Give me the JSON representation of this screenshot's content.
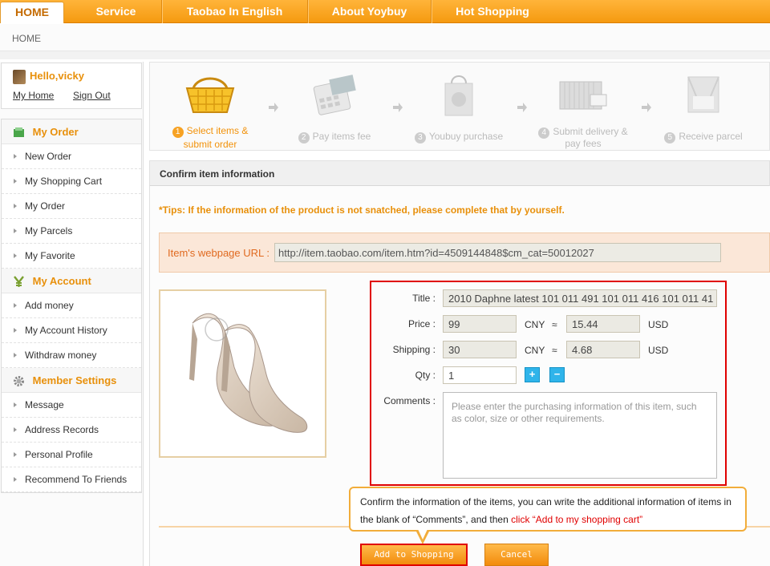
{
  "nav": {
    "home": "HOME",
    "service": "Service",
    "taobao": "Taobao In English",
    "about": "About Yoybuy",
    "hot": "Hot Shopping"
  },
  "breadcrumb": "HOME",
  "user": {
    "greeting": "Hello,vicky",
    "my_home": "My Home",
    "sign_out": "Sign Out"
  },
  "sidebar": {
    "order_head": "My Order",
    "order_items": [
      "New Order",
      "My Shopping Cart",
      "My Order",
      "My Parcels",
      "My Favorite"
    ],
    "account_head": "My Account",
    "account_items": [
      "Add money",
      "My Account History",
      "Withdraw money"
    ],
    "settings_head": "Member Settings",
    "settings_items": [
      "Message",
      "Address Records",
      "Personal Profile",
      "Recommend To Friends"
    ]
  },
  "steps": [
    {
      "num": "1",
      "line1": "Select items &",
      "line2": "submit order"
    },
    {
      "num": "2",
      "line1": "Pay items fee",
      "line2": ""
    },
    {
      "num": "3",
      "line1": "Youbuy purchase",
      "line2": ""
    },
    {
      "num": "4",
      "line1": "Submit delivery &",
      "line2": "pay fees"
    },
    {
      "num": "5",
      "line1": "Receive parcel",
      "line2": ""
    }
  ],
  "confirm": {
    "title": "Confirm item information",
    "tips": "*Tips: If the information of the product is not snatched, please complete that by yourself.",
    "url_label": "Item's webpage URL :",
    "url_value": "http://item.taobao.com/item.htm?id=4509144848$cm_cat=50012027"
  },
  "form": {
    "title_label": "Title :",
    "title_value": "2010 Daphne latest 101 011 491 101 011 416 101 011 41",
    "price_label": "Price :",
    "price_value": "99",
    "currency_cny": "CNY",
    "approx": "≈",
    "price_usd": "15.44",
    "currency_usd": "USD",
    "shipping_label": "Shipping :",
    "shipping_value": "30",
    "shipping_usd": "4.68",
    "qty_label": "Qty :",
    "qty_value": "1",
    "plus": "+",
    "minus": "−",
    "comments_label": "Comments :",
    "comments_placeholder": "Please enter the purchasing information of this item, such as color, size or other requirements."
  },
  "tooltip": {
    "text": "Confirm the information of the items, you can write the additional information of items in the blank of “Comments”, and then ",
    "highlight": "click “Add to my shopping cart”"
  },
  "buttons": {
    "add": "Add to Shopping Cart",
    "cancel": "Cancel"
  },
  "colors": {
    "accent_orange": "#f59a10",
    "alert_red": "#e00000"
  }
}
